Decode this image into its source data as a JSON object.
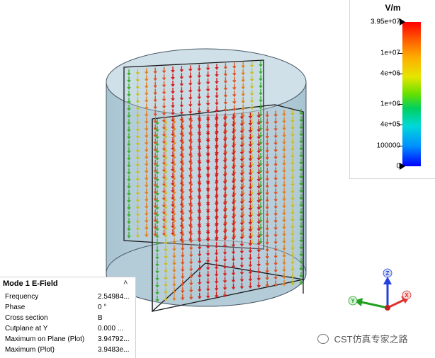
{
  "legend": {
    "unit": "V/m",
    "ticks": [
      {
        "label": "3.95e+07",
        "level": 1.0,
        "pointer": true
      },
      {
        "label": "1e+07",
        "level": 0.785
      },
      {
        "label": "4e+06",
        "level": 0.64
      },
      {
        "label": "1e+06",
        "level": 0.43
      },
      {
        "label": "4e+05",
        "level": 0.29
      },
      {
        "label": "100000",
        "level": 0.14
      },
      {
        "label": "0",
        "level": 0.0,
        "pointer": true
      }
    ]
  },
  "info_panel": {
    "title": "Mode 1 E-Field",
    "collapse_icon": "chevron-up-icon",
    "rows": [
      {
        "label": "Frequency",
        "value": "2.54984..."
      },
      {
        "label": "Phase",
        "value": "0 °"
      },
      {
        "label": "Cross section",
        "value": "B"
      },
      {
        "label": "Cutplane at Y",
        "value": "0.000 ..."
      },
      {
        "label": "Maximum on Plane (Plot)",
        "value": "3.94792..."
      },
      {
        "label": "Maximum (Plot)",
        "value": "3.9483e..."
      }
    ]
  },
  "axes": {
    "x": "X",
    "y": "Y",
    "z": "Z"
  },
  "watermark": "CST仿真专家之路",
  "colors": {
    "cylinder_fill": "#b8d0dc",
    "cylinder_edge": "#444444",
    "arrow_strong": "#d42020",
    "arrow_mid": "#e08020",
    "arrow_weak": "#40b030",
    "axis_x": "#e03030",
    "axis_y": "#20a020",
    "axis_z": "#2040e0"
  }
}
